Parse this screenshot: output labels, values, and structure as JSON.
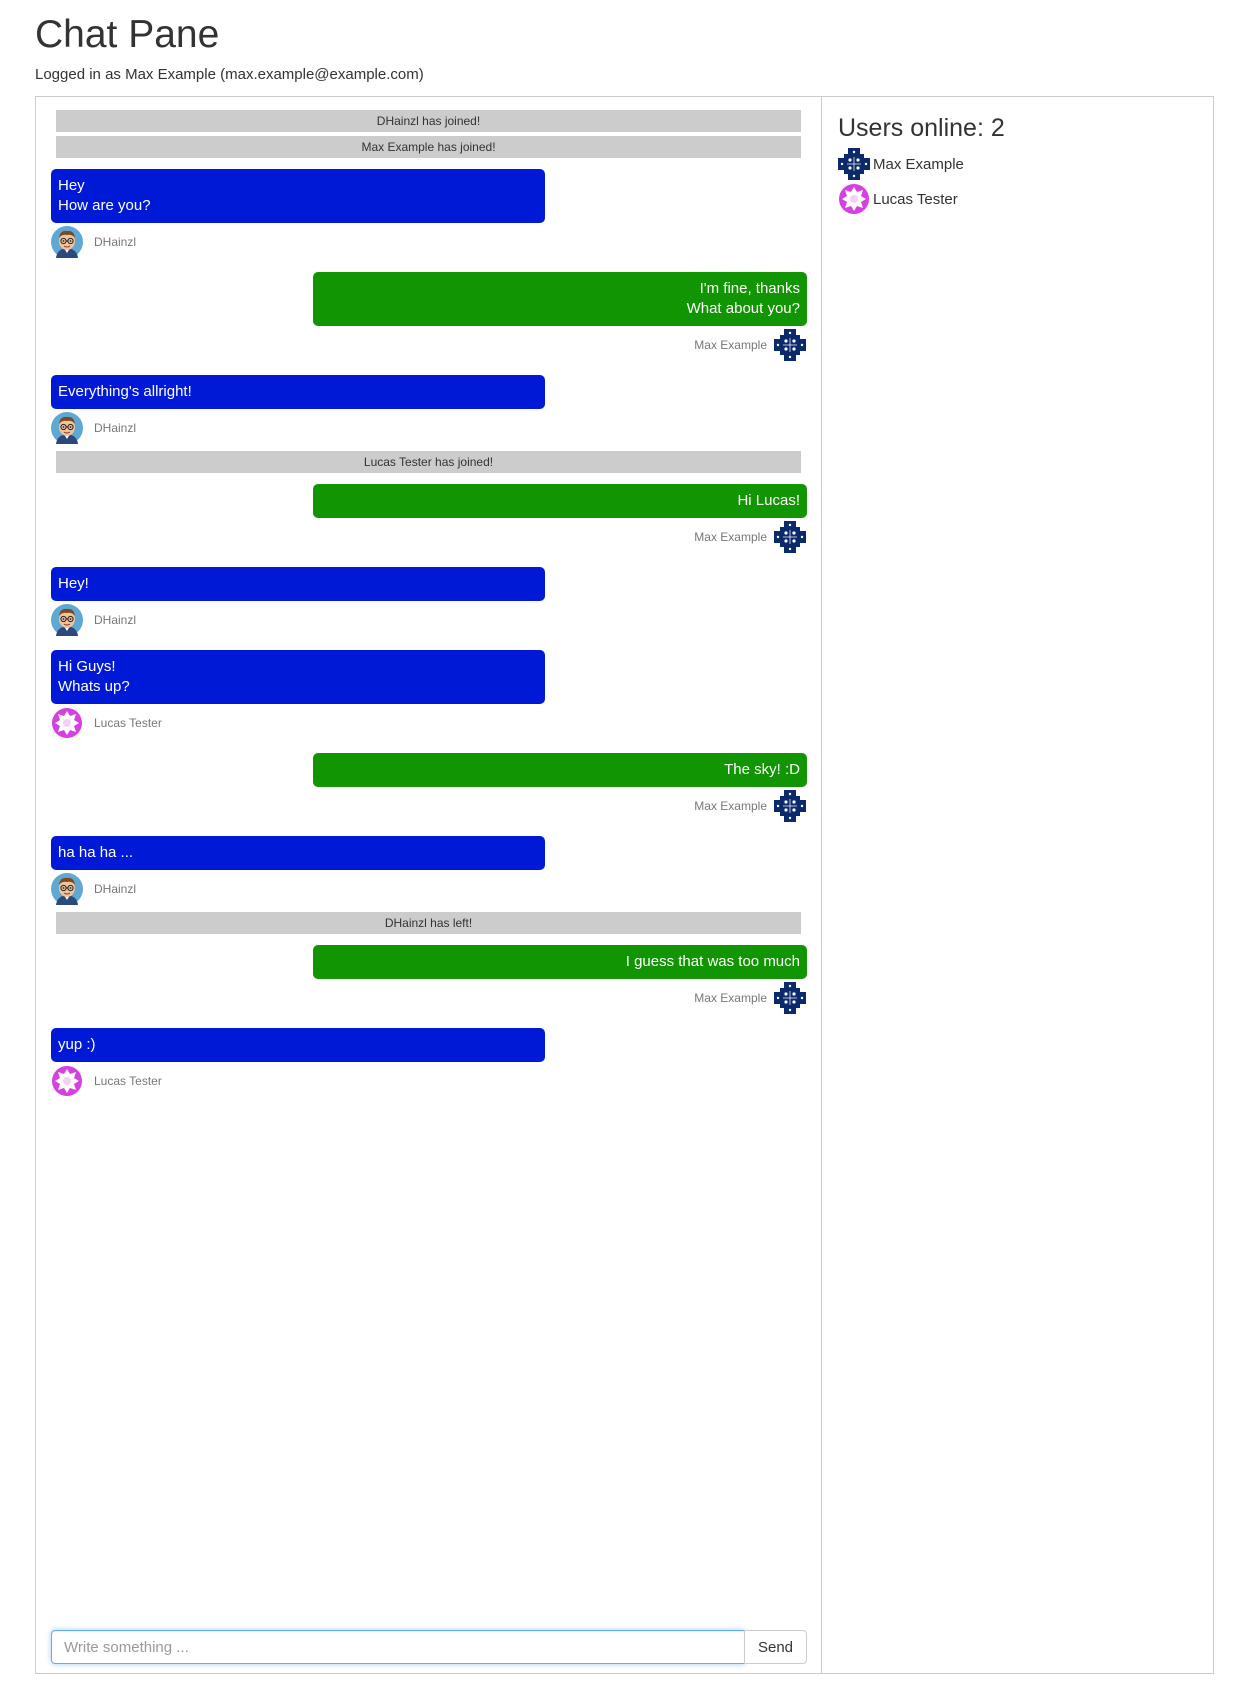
{
  "header": {
    "title": "Chat Pane",
    "logged_in_text": "Logged in as Max Example (max.example@example.com)"
  },
  "chat": {
    "messages": [
      {
        "kind": "system",
        "text": "DHainzl has joined!"
      },
      {
        "kind": "system",
        "text": "Max Example has joined!"
      },
      {
        "kind": "incoming",
        "lines": [
          "Hey",
          "How are you?"
        ],
        "author": "DHainzl",
        "avatar": "cartoon-face-avatar"
      },
      {
        "kind": "outgoing",
        "lines": [
          "I'm fine, thanks",
          "What about you?"
        ],
        "author": "Max Example",
        "avatar": "navy-pattern-avatar"
      },
      {
        "kind": "incoming",
        "lines": [
          "Everything's allright!"
        ],
        "author": "DHainzl",
        "avatar": "cartoon-face-avatar"
      },
      {
        "kind": "system",
        "text": "Lucas Tester has joined!"
      },
      {
        "kind": "outgoing",
        "lines": [
          "Hi Lucas!"
        ],
        "author": "Max Example",
        "avatar": "navy-pattern-avatar"
      },
      {
        "kind": "incoming",
        "lines": [
          "Hey!"
        ],
        "author": "DHainzl",
        "avatar": "cartoon-face-avatar"
      },
      {
        "kind": "incoming",
        "lines": [
          "Hi Guys!",
          "Whats up?"
        ],
        "author": "Lucas Tester",
        "avatar": "magenta-pattern-avatar"
      },
      {
        "kind": "outgoing",
        "lines": [
          "The sky! :D"
        ],
        "author": "Max Example",
        "avatar": "navy-pattern-avatar"
      },
      {
        "kind": "incoming",
        "lines": [
          "ha ha ha ..."
        ],
        "author": "DHainzl",
        "avatar": "cartoon-face-avatar"
      },
      {
        "kind": "system",
        "text": "DHainzl has left!"
      },
      {
        "kind": "outgoing",
        "lines": [
          "I guess that was too much"
        ],
        "author": "Max Example",
        "avatar": "navy-pattern-avatar"
      },
      {
        "kind": "incoming",
        "lines": [
          "yup :)"
        ],
        "author": "Lucas Tester",
        "avatar": "magenta-pattern-avatar"
      }
    ],
    "input": {
      "value": "",
      "placeholder": "Write something ..."
    },
    "send_label": "Send"
  },
  "sidebar": {
    "heading": "Users online: 2",
    "users": [
      {
        "name": "Max Example",
        "avatar": "navy-pattern-avatar"
      },
      {
        "name": "Lucas Tester",
        "avatar": "magenta-pattern-avatar"
      }
    ]
  },
  "colors": {
    "incoming_bubble": "#0019d6",
    "outgoing_bubble": "#119502",
    "system_message": "#cccccc",
    "navy_avatar": "#0b2a6b",
    "magenta_avatar": "#d63fe0"
  }
}
